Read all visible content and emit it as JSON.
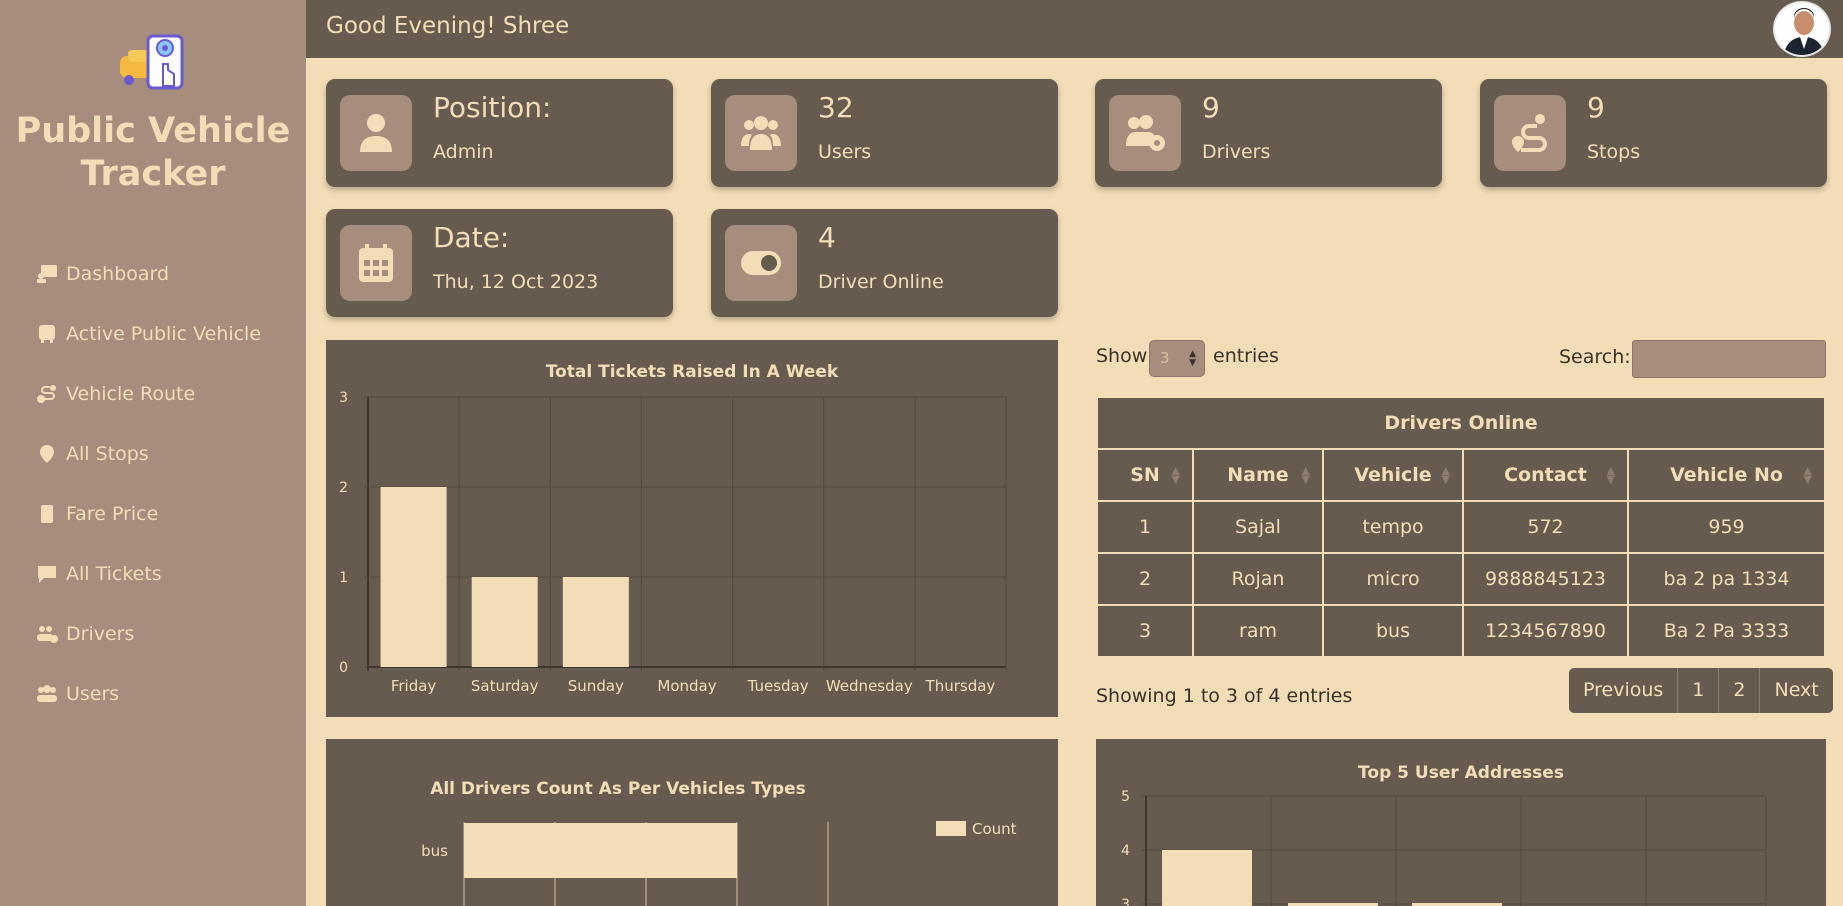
{
  "app": {
    "title": "Public Vehicle Tracker"
  },
  "header": {
    "greeting": "Good Evening! Shree"
  },
  "sidebar": {
    "items": [
      {
        "label": "Dashboard",
        "icon": "dashboard-icon"
      },
      {
        "label": "Active Public Vehicle",
        "icon": "bus-icon"
      },
      {
        "label": "Vehicle Route",
        "icon": "route-icon"
      },
      {
        "label": "All Stops",
        "icon": "map-pin-icon"
      },
      {
        "label": "Fare Price",
        "icon": "calculator-icon"
      },
      {
        "label": "All Tickets",
        "icon": "message-icon"
      },
      {
        "label": "Drivers",
        "icon": "users-gear-icon"
      },
      {
        "label": "Users",
        "icon": "users-icon"
      }
    ]
  },
  "cards": [
    {
      "big": "Position:",
      "small": "Admin",
      "icon": "user-tie-icon"
    },
    {
      "big": "32",
      "small": "Users",
      "icon": "users-icon"
    },
    {
      "big": "9",
      "small": "Drivers",
      "icon": "users-gear-icon"
    },
    {
      "big": "9",
      "small": "Stops",
      "icon": "route-icon"
    },
    {
      "big": "Date:",
      "small": "Thu, 12 Oct 2023",
      "icon": "calendar-icon"
    },
    {
      "big": "4",
      "small": "Driver Online",
      "icon": "toggle-icon"
    }
  ],
  "table": {
    "show": "Show",
    "entries": "entries",
    "length_value": "3",
    "search_label": "Search:",
    "caption": "Drivers Online",
    "headers": [
      "SN",
      "Name",
      "Vehicle",
      "Contact",
      "Vehicle No"
    ],
    "rows": [
      [
        "1",
        "Sajal",
        "tempo",
        "572",
        "959"
      ],
      [
        "2",
        "Rojan",
        "micro",
        "9888845123",
        "ba 2 pa 1334"
      ],
      [
        "3",
        "ram",
        "bus",
        "1234567890",
        "Ba 2 Pa 3333"
      ]
    ],
    "info": "Showing 1 to 3 of 4 entries",
    "pager": [
      "Previous",
      "1",
      "2",
      "Next"
    ]
  },
  "chart_data": [
    {
      "type": "bar",
      "title": "Total Tickets Raised In A Week",
      "categories": [
        "Friday",
        "Saturday",
        "Sunday",
        "Monday",
        "Tuesday",
        "Wednesday",
        "Thursday"
      ],
      "values": [
        2,
        1,
        1,
        0,
        0,
        0,
        0
      ],
      "yticks": [
        "0",
        "1",
        "2",
        "3"
      ],
      "ylim": [
        0,
        3
      ],
      "grid": true,
      "color": "#f3ddb7"
    },
    {
      "type": "bar",
      "orientation": "horizontal",
      "title": "All Drivers Count As Per Vehicles Types",
      "categories": [
        "bus"
      ],
      "series": [
        {
          "name": "Count",
          "values": [
            3
          ]
        }
      ],
      "legend": "top-right",
      "color": "#f3ddb7"
    },
    {
      "type": "bar",
      "title": "Top 5 User Addresses",
      "yticks": [
        "3",
        "4",
        "5"
      ],
      "ylim": [
        0,
        5
      ],
      "values": [
        4
      ],
      "grid": true,
      "color": "#f3ddb7"
    }
  ]
}
